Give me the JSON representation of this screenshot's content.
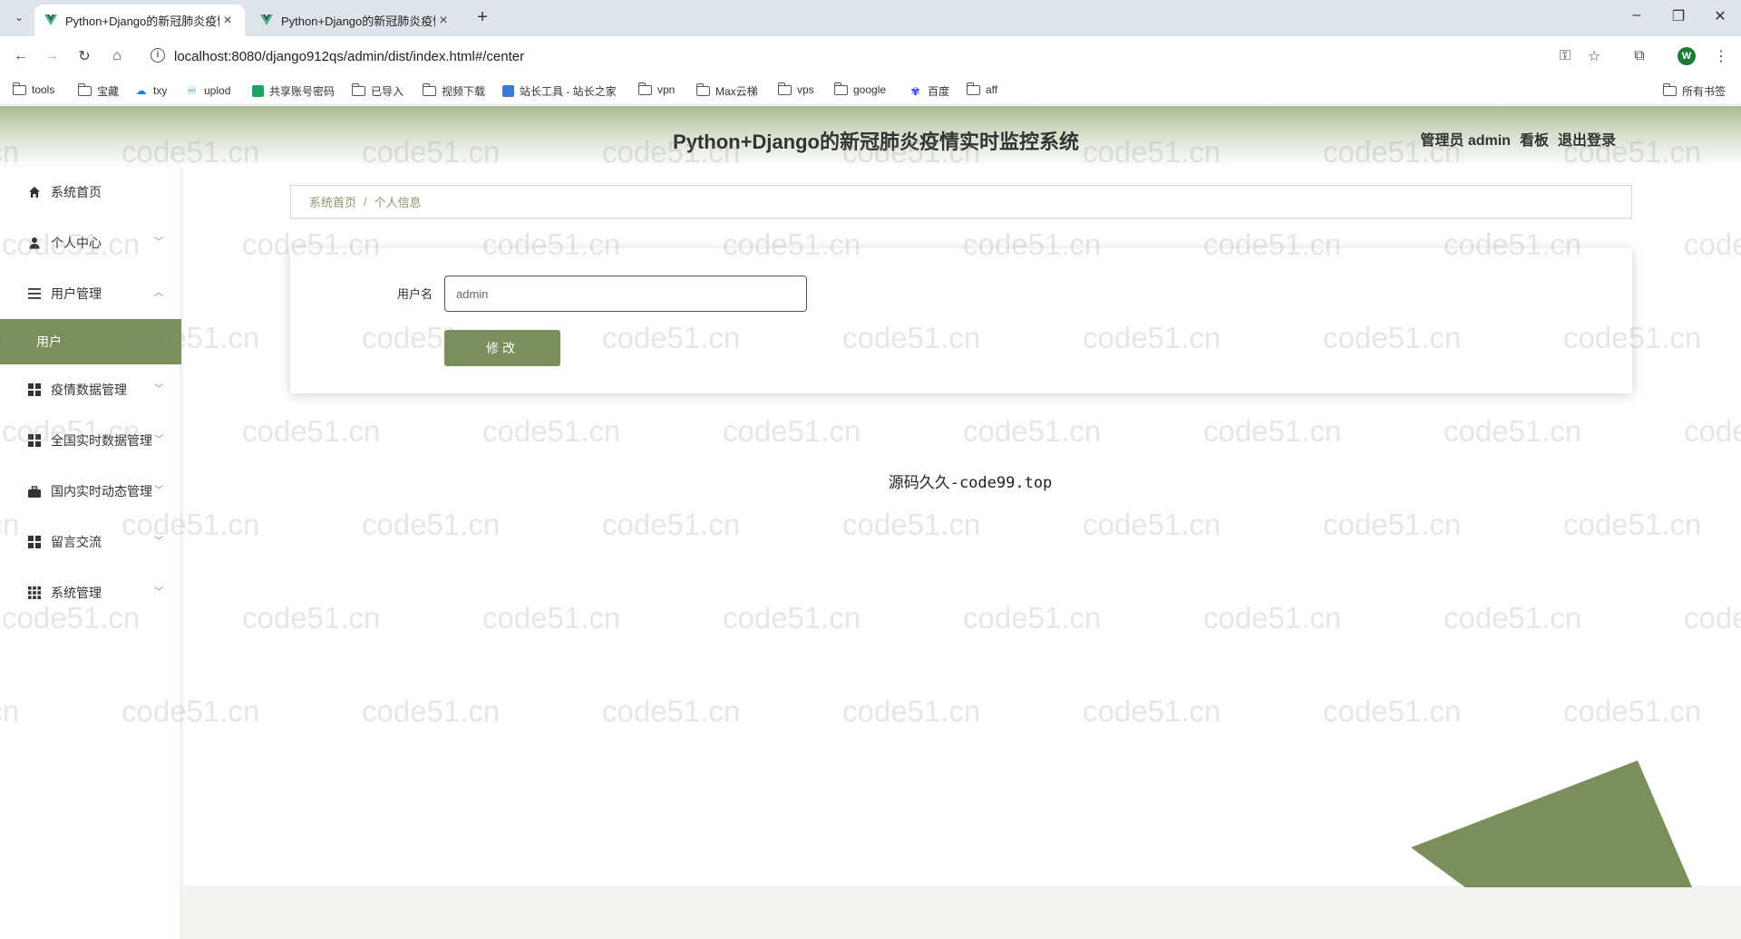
{
  "browser": {
    "tabs": [
      {
        "title": "Python+Django的新冠肺炎疫情实时监控系统"
      },
      {
        "title": "Python+Django的新冠肺炎疫情实时监控系统"
      }
    ],
    "url": "localhost:8080/django912qs/admin/dist/index.html#/center",
    "profile_initial": "W",
    "bookmarks": [
      "tools",
      "宝藏",
      "txy",
      "uplod",
      "共享账号密码",
      "已导入",
      "视频下载",
      "站长工具 - 站长之家",
      "vpn",
      "Max云梯",
      "vps",
      "google",
      "百度",
      "aff"
    ],
    "all_bookmarks": "所有书签"
  },
  "header": {
    "title": "Python+Django的新冠肺炎疫情实时监控系统",
    "user_label": "管理员 admin",
    "dashboard_link": "看板",
    "logout_link": "退出登录"
  },
  "sidebar": {
    "items": [
      {
        "label": "系统首页",
        "icon": "home-icon"
      },
      {
        "label": "个人中心",
        "icon": "user-icon"
      },
      {
        "label": "用户管理",
        "icon": "list-icon"
      },
      {
        "label": "用户",
        "sub": true
      },
      {
        "label": "疫情数据管理",
        "icon": "grid-icon"
      },
      {
        "label": "全国实时数据管理",
        "icon": "grid-icon"
      },
      {
        "label": "国内实时动态管理",
        "icon": "briefcase-icon"
      },
      {
        "label": "留言交流",
        "icon": "grid-icon"
      },
      {
        "label": "系统管理",
        "icon": "apps-icon"
      }
    ]
  },
  "breadcrumb": {
    "home": "系统首页",
    "separator": "/",
    "current": "个人信息"
  },
  "form": {
    "username_label": "用户名",
    "username_value": "admin",
    "submit_label": "修改"
  },
  "footer": {
    "text": "源码久久-code99.top"
  },
  "watermark": {
    "text": "code51.cn"
  },
  "colors": {
    "accent": "#7a8f5b",
    "header_top": "#a9b994"
  }
}
